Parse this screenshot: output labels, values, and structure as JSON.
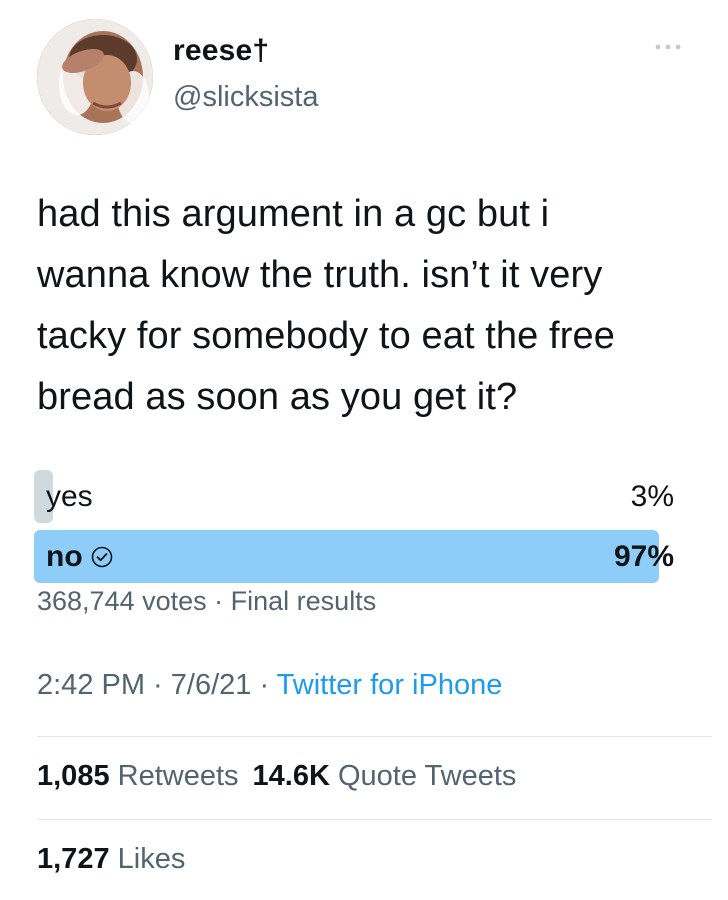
{
  "user": {
    "display_name": "reese†",
    "handle": "@slicksista"
  },
  "tweet": {
    "lines": [
      "had this argument in a gc but i",
      "wanna know the truth. isn’t it very",
      "tacky for somebody to eat the free",
      "bread as soon as you get it?"
    ]
  },
  "poll": {
    "options": [
      {
        "label": "yes",
        "percent_text": "3%",
        "percent": 3,
        "winner": false,
        "bar_color": "#cfd9de"
      },
      {
        "label": "no",
        "percent_text": "97%",
        "percent": 97,
        "winner": true,
        "bar_color": "#8ecdf8"
      }
    ],
    "votes": "368,744 votes",
    "status": "Final results",
    "separator": " · "
  },
  "meta": {
    "time": "2:42 PM",
    "date": "7/6/21",
    "source": "Twitter for iPhone",
    "separator": " · "
  },
  "stats": {
    "retweets_count": "1,085",
    "retweets_label": "Retweets",
    "quotes_count": "14.6K",
    "quotes_label": "Quote Tweets",
    "likes_count": "1,727",
    "likes_label": "Likes"
  },
  "colors": {
    "text": "#0f1419",
    "secondary": "#536471",
    "link": "#1d9bf0"
  },
  "icons": {
    "more": "more-icon",
    "check": "check-circle-icon"
  }
}
